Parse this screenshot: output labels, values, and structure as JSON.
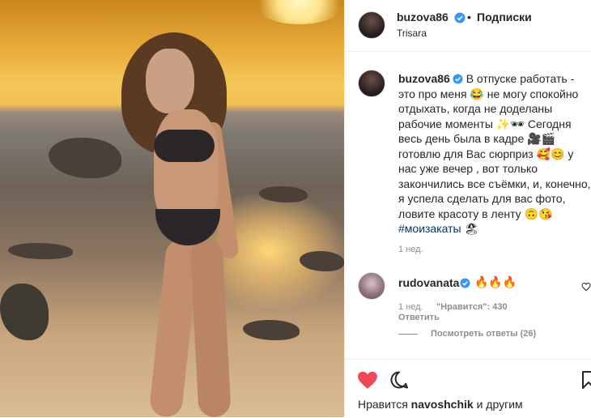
{
  "post": {
    "author": "buzova86",
    "location": "Trisara",
    "follow_label": "Подписки",
    "dot": "•"
  },
  "caption": {
    "author": "buzova86",
    "text_1": " В отпуске работать - это про меня 😂 не могу спокойно отдыхать, когда не доделаны рабочие моменты ✨🕶 Сегодня весь день была в кадре 🎥🎬 готовлю для Вас сюрприз 🥰😊 у нас уже вечер , вот только закончились все съёмки, и, конечно, я успела сделать для вас фото, ловите красоту в ленту 🙃😘",
    "hashtag": "#моизакаты",
    "text_2": " 🏖",
    "time": "1 нед."
  },
  "comment": {
    "author": "rudovanata",
    "text": "🔥🔥🔥",
    "time": "1 нед.",
    "likes": "\"Нравится\": 430",
    "reply": "Ответить",
    "view_replies": "Посмотреть ответы (26)"
  },
  "likes": {
    "prefix": "Нравится ",
    "user": "navoshchik",
    "suffix": " и другим"
  },
  "colors": {
    "like_red": "#ed4956",
    "verified_blue": "#3897f0",
    "text": "#262626",
    "muted": "#8e8e8e"
  },
  "icons": {
    "verified": "verified-badge-icon",
    "like": "heart-icon",
    "comment": "comment-icon",
    "save": "bookmark-icon"
  }
}
